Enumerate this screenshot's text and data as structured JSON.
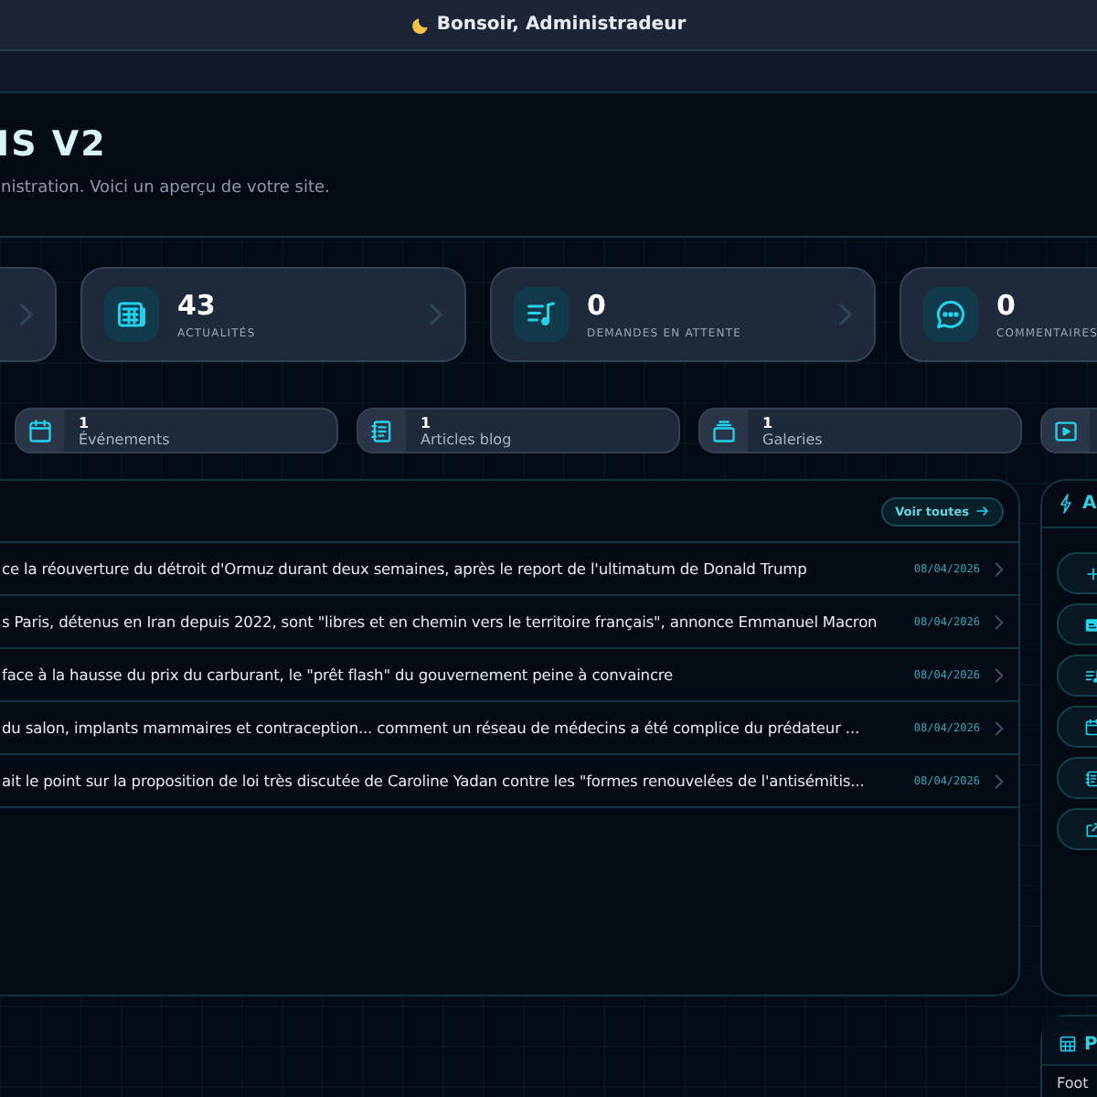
{
  "topbar": {
    "greeting": "Bonsoir, Administradeur"
  },
  "header": {
    "title": "IS V2",
    "subtitle": "inistration. Voici un aperçu de votre site."
  },
  "stats": [
    {
      "value": "43",
      "label": "ACTUALITÉS"
    },
    {
      "value": "0",
      "label": "DEMANDES EN ATTENTE"
    },
    {
      "value": "0",
      "label": "COMMENTAIRES"
    }
  ],
  "mini_stats": [
    {
      "value": "1",
      "label": "Événements"
    },
    {
      "value": "1",
      "label": "Articles blog"
    },
    {
      "value": "1",
      "label": "Galeries"
    }
  ],
  "news": {
    "button": "Voir toutes",
    "rows": [
      {
        "title": "ce la réouverture du détroit d'Ormuz durant deux semaines, après le report de l'ultimatum de Donald Trump",
        "date": "08/04/2026"
      },
      {
        "title": "s Paris, détenus en Iran depuis 2022, sont \"libres et en chemin vers le territoire français\", annonce Emmanuel Macron",
        "date": "08/04/2026"
      },
      {
        "title": "face à la hausse du prix du carburant, le \"prêt flash\" du gouvernement peine à convaincre",
        "date": "08/04/2026"
      },
      {
        "title": "du salon, implants mammaires et contraception... comment un réseau de médecins a été complice du prédateur ...",
        "date": "08/04/2026"
      },
      {
        "title": "ait le point sur la proposition de loi très discutée de Caroline Yadan contre les \"formes renouvelées de l'antisémitis...",
        "date": "08/04/2026"
      }
    ]
  },
  "actions": {
    "title": "A"
  },
  "bottom_panel": {
    "title": "P",
    "text": "Foot"
  }
}
